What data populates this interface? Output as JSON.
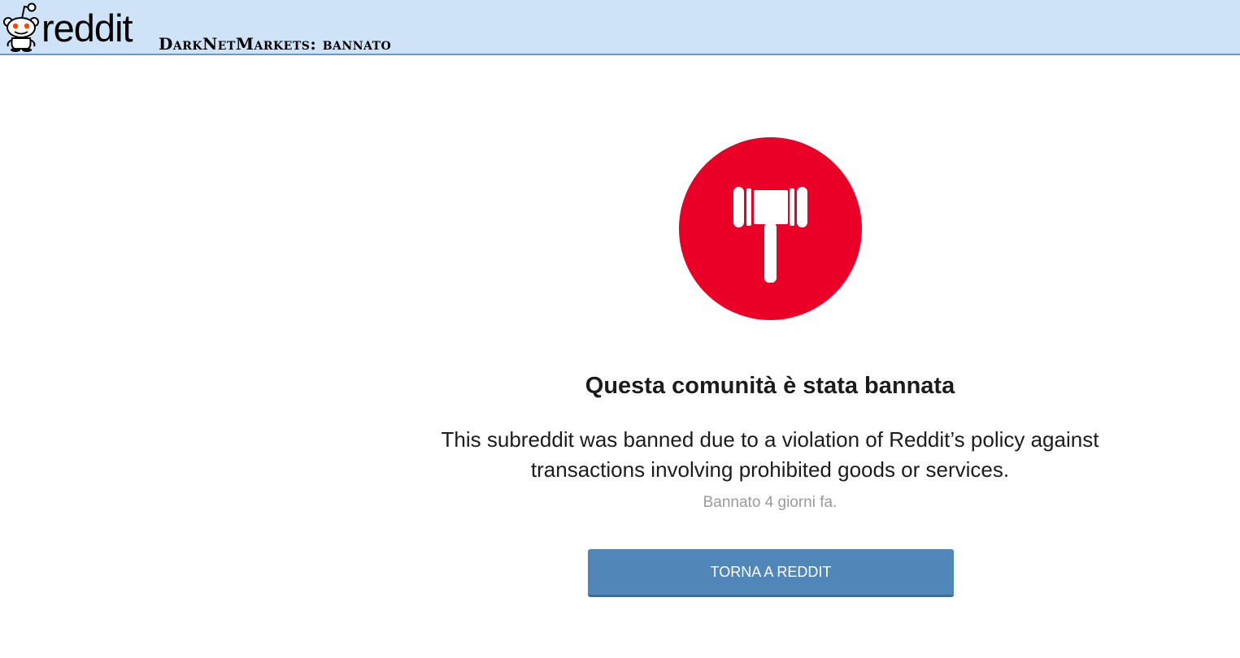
{
  "header": {
    "logo_text": "reddit",
    "page_name": "DarkNetMarkets: bannato"
  },
  "ban_notice": {
    "icon": "gavel-icon",
    "title": "Questa comunità è stata bannata",
    "message_lines": [
      "This subreddit was banned due to a violation of Reddit’s policy against",
      "transactions involving prohibited goods or services."
    ],
    "timestamp": "Bannato 4 giorni fa.",
    "button_label": "TORNA A REDDIT"
  },
  "colors": {
    "header_bg": "#cee3f8",
    "header_border": "#5f99cf",
    "ban_red": "#ea0027",
    "button_blue": "#5087b8",
    "timestamp_gray": "#9a9a9a"
  }
}
